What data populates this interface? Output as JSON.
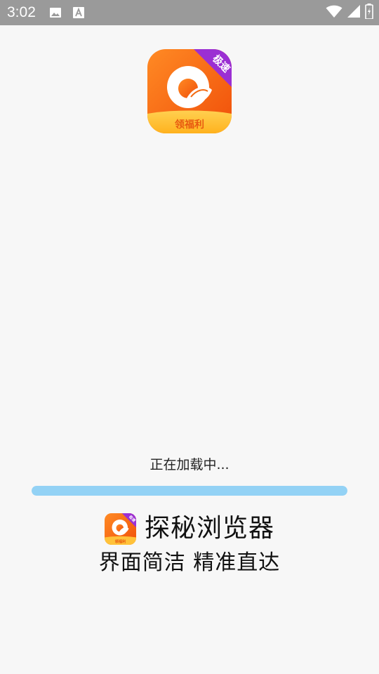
{
  "status_bar": {
    "time": "3:02",
    "notification_icons": [
      "image-icon",
      "font-download-icon"
    ],
    "system_icons": [
      "wifi-icon",
      "signal-icon",
      "battery-icon"
    ]
  },
  "app_icon": {
    "badge_text": "极速",
    "banner_text": "领福利"
  },
  "loading": {
    "text": "正在加载中...",
    "progress": 1.0
  },
  "brand": {
    "name": "探秘浏览器",
    "slogan": "界面简洁 精准直达",
    "small_icon_badge": "极速",
    "small_icon_banner": "领福利"
  },
  "colors": {
    "status_bar_bg": "#9a9a9a",
    "icon_orange": "#f36a12",
    "icon_badge_purple": "#9b2fd3",
    "progress_fill": "#93d2f5",
    "background": "#f7f7f7"
  }
}
